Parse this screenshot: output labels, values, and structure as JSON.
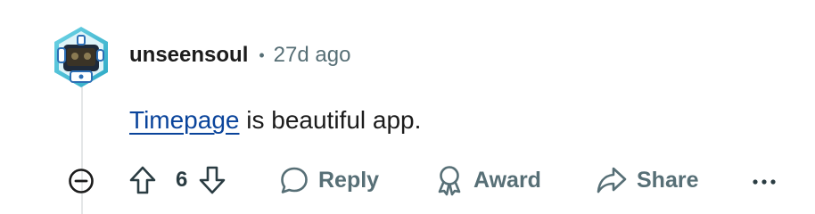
{
  "comment": {
    "author": "unseensoul",
    "separator": "•",
    "age": "27d ago",
    "body": {
      "link_text": "Timepage",
      "rest_text": " is beautiful app."
    },
    "score": "6"
  },
  "actions": {
    "reply_label": "Reply",
    "award_label": "Award",
    "share_label": "Share"
  },
  "icons": {
    "collapse": "minus-circle-icon",
    "upvote": "arrow-up-icon",
    "downvote": "arrow-down-icon",
    "reply": "speech-bubble-icon",
    "award": "award-ribbon-icon",
    "share": "share-arrow-icon",
    "more": "ellipsis-icon"
  },
  "colors": {
    "link": "#0a449b",
    "meta": "#576f76",
    "text": "#1c1c1c",
    "thread_line": "#e4e6e8",
    "avatar_ring": "#3ec2d6"
  }
}
